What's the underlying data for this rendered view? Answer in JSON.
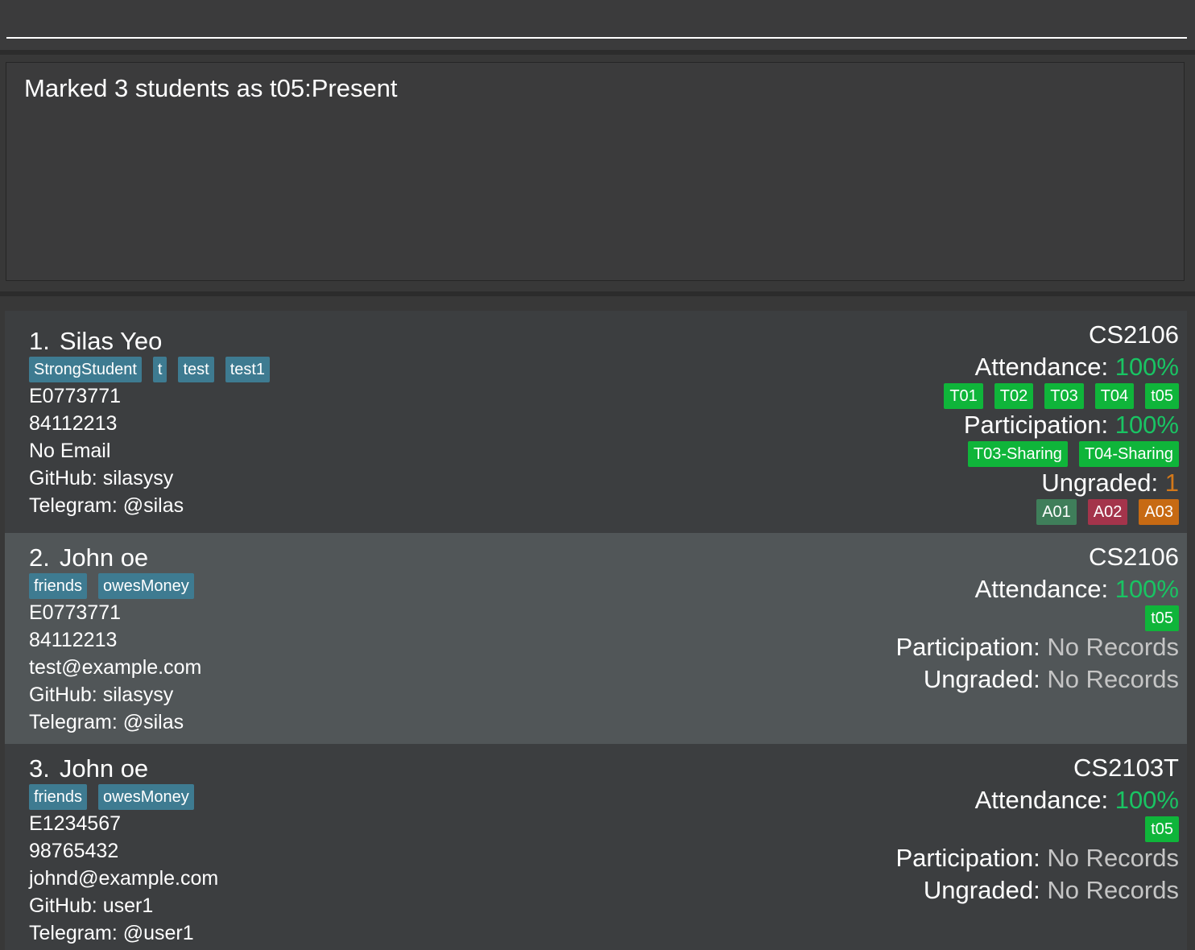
{
  "command": {
    "value": "",
    "placeholder": ""
  },
  "result": {
    "message": "Marked 3 students as t05:Present"
  },
  "colors": {
    "background": "#383838",
    "tag": "#3e7b91",
    "attendance_tag": "#0fb53a",
    "percent_text": "#19c463",
    "ungraded_count": "#d3781a",
    "assignment_graded": "#3f7e5a",
    "assignment_late": "#a4344b",
    "assignment_ungraded": "#c76a13",
    "selected_row": "#515658"
  },
  "students": [
    {
      "index": "1.",
      "name": "Silas Yeo",
      "tags": [
        "StrongStudent",
        "t",
        "test",
        "test1"
      ],
      "id": "E0773771",
      "phone": "84112213",
      "email": "No Email",
      "github": "GitHub: silasysy",
      "telegram": "Telegram: @silas",
      "course": "CS2106",
      "attendance_label": "Attendance: ",
      "attendance_value": "100%",
      "attendance_tags": [
        "T01",
        "T02",
        "T03",
        "T04",
        "t05"
      ],
      "participation_label": "Participation: ",
      "participation_value": "100%",
      "participation_tags": [
        "T03-Sharing",
        "T04-Sharing"
      ],
      "ungraded_label": "Ungraded: ",
      "ungraded_value": "1",
      "assignments": [
        {
          "label": "A01",
          "status": "graded"
        },
        {
          "label": "A02",
          "status": "late"
        },
        {
          "label": "A03",
          "status": "ungraded"
        }
      ]
    },
    {
      "index": "2.",
      "name": "John oe",
      "tags": [
        "friends",
        "owesMoney"
      ],
      "id": "E0773771",
      "phone": "84112213",
      "email": "test@example.com",
      "github": "GitHub: silasysy",
      "telegram": "Telegram: @silas",
      "course": "CS2106",
      "attendance_label": "Attendance: ",
      "attendance_value": "100%",
      "attendance_tags": [
        "t05"
      ],
      "participation_label": "Participation: ",
      "participation_value": "No Records",
      "ungraded_label": "Ungraded: ",
      "ungraded_value": "No Records"
    },
    {
      "index": "3.",
      "name": "John oe",
      "tags": [
        "friends",
        "owesMoney"
      ],
      "id": "E1234567",
      "phone": "98765432",
      "email": "johnd@example.com",
      "github": "GitHub: user1",
      "telegram": "Telegram: @user1",
      "course": "CS2103T",
      "attendance_label": "Attendance: ",
      "attendance_value": "100%",
      "attendance_tags": [
        "t05"
      ],
      "participation_label": "Participation: ",
      "participation_value": "No Records",
      "ungraded_label": "Ungraded: ",
      "ungraded_value": "No Records"
    }
  ]
}
